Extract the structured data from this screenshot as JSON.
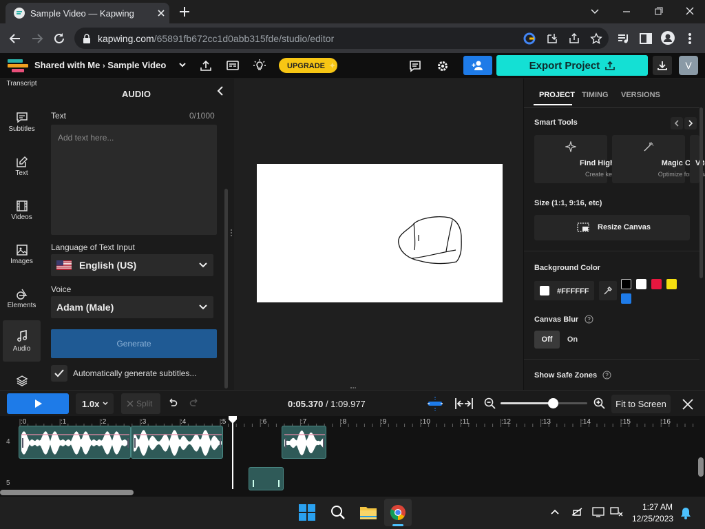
{
  "browser": {
    "tab_title": "Sample Video — Kapwing",
    "url_host": "kapwing.com",
    "url_path": "/65891fb672cc1d0abb315fde/studio/editor"
  },
  "header": {
    "breadcrumb_parent": "Shared with Me",
    "project_name": "Sample Video",
    "upgrade_label": "UPGRADE",
    "export_label": "Export Project",
    "avatar_initial": "V"
  },
  "sidebar": {
    "items": [
      {
        "label": "Transcript",
        "icon": "transcript-icon"
      },
      {
        "label": "Subtitles",
        "icon": "subtitles-icon"
      },
      {
        "label": "Text",
        "icon": "text-icon"
      },
      {
        "label": "Videos",
        "icon": "film-icon"
      },
      {
        "label": "Images",
        "icon": "image-icon"
      },
      {
        "label": "Elements",
        "icon": "elements-icon"
      },
      {
        "label": "Audio",
        "icon": "music-note-icon",
        "active": true
      },
      {
        "label": "",
        "icon": "layers-icon"
      }
    ]
  },
  "audio_panel": {
    "title": "AUDIO",
    "text_label": "Text",
    "char_count": "0/1000",
    "text_placeholder": "Add text here...",
    "language_label": "Language of Text Input",
    "language_value": "English (US)",
    "voice_label": "Voice",
    "voice_value": "Adam (Male)",
    "generate_label": "Generate",
    "auto_subtitles_label": "Automatically generate subtitles...",
    "auto_subtitles_checked": true
  },
  "properties": {
    "tabs": [
      "PROJECT",
      "TIMING",
      "VERSIONS"
    ],
    "active_tab": "PROJECT",
    "smart_tools_title": "Smart Tools",
    "tools": [
      {
        "title": "Find Highlights",
        "subtitle": "Create key clips"
      },
      {
        "title": "Magic Create",
        "subtitle": "Optimize for socials"
      },
      {
        "title": "V",
        "subtitle": ""
      }
    ],
    "size_title": "Size (1:1, 9:16, etc)",
    "resize_label": "Resize Canvas",
    "bg_color_title": "Background Color",
    "bg_color_value": "#FFFFFF",
    "swatches": [
      "#000000",
      "#ffffff",
      "#e8173f",
      "#f5e010",
      "#1e7be8"
    ],
    "canvas_blur_title": "Canvas Blur",
    "blur_off": "Off",
    "blur_on": "On",
    "blur_state": "Off",
    "safe_zones_title": "Show Safe Zones"
  },
  "timeline": {
    "speed": "1.0x",
    "split_label": "Split",
    "current_time": "0:05.370",
    "total_time": "/ 1:09.977",
    "fit_label": "Fit to Screen",
    "ruler_labels": [
      ":0",
      ":1",
      ":2",
      ":3",
      ":4",
      ":5",
      ":6",
      ":7",
      ":8",
      ":9",
      ":10",
      ":11",
      ":12",
      ":13",
      ":14",
      ":15",
      ":16"
    ],
    "track_numbers": [
      "4",
      "5"
    ],
    "zoom_level": 0.6
  },
  "taskbar": {
    "time": "1:27 AM",
    "date": "12/25/2023"
  }
}
